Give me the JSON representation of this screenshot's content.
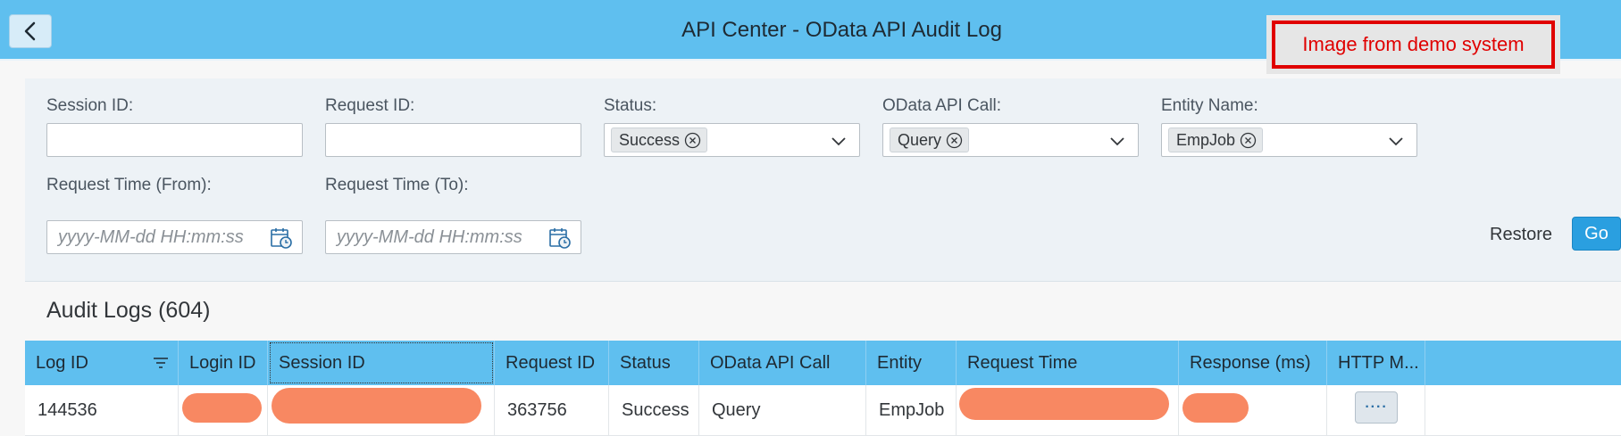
{
  "header": {
    "title": "API Center - OData API Audit Log",
    "back_icon": "chevron-left-icon",
    "bg_color": "#5fbfef"
  },
  "demo_stamp": {
    "text": "Image from demo system",
    "color": "#e00000"
  },
  "filters": {
    "session_id": {
      "label": "Session ID:",
      "value": ""
    },
    "request_id": {
      "label": "Request ID:",
      "value": ""
    },
    "status": {
      "label": "Status:",
      "tokens": [
        "Success"
      ]
    },
    "odata_api_call": {
      "label": "OData API Call:",
      "tokens": [
        "Query"
      ]
    },
    "entity_name": {
      "label": "Entity Name:",
      "tokens": [
        "EmpJob"
      ]
    },
    "request_time_from": {
      "label": "Request Time (From):",
      "placeholder": "yyyy-MM-dd HH:mm:ss"
    },
    "request_time_to": {
      "label": "Request Time (To):",
      "placeholder": "yyyy-MM-dd HH:mm:ss"
    },
    "restore_label": "Restore",
    "go_label": "Go"
  },
  "table": {
    "title": "Audit Logs (604)",
    "columns": [
      "Log ID",
      "Login ID",
      "Session ID",
      "Request ID",
      "Status",
      "OData API Call",
      "Entity",
      "Request Time",
      "Response (ms)",
      "HTTP M..."
    ],
    "rows": [
      {
        "log_id": "144536",
        "login_id": "",
        "session_id": "",
        "request_id": "363756",
        "status": "Success",
        "odata_api_call": "Query",
        "entity": "EmpJob",
        "request_time": "",
        "response_ms": "",
        "http_method_action": "····"
      }
    ]
  },
  "colors": {
    "accent": "#2a9fe0",
    "redaction": "#f88862"
  }
}
